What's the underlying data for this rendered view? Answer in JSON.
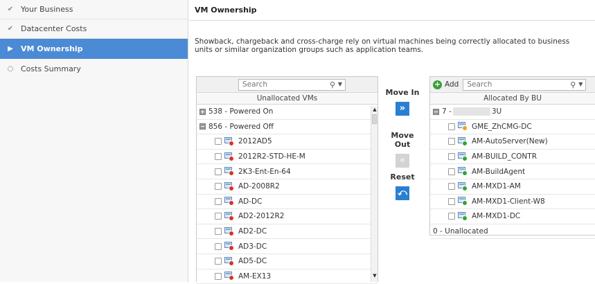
{
  "wizard": {
    "steps": [
      {
        "label": "Your Business",
        "state": "done"
      },
      {
        "label": "Datacenter Costs",
        "state": "done"
      },
      {
        "label": "VM Ownership",
        "state": "active"
      },
      {
        "label": "Costs Summary",
        "state": "pending"
      }
    ]
  },
  "page": {
    "title": "VM Ownership",
    "description": "Showback, chargeback and cross-charge rely on virtual machines being correctly allocated to business units or similar organization groups such as application teams."
  },
  "left_panel": {
    "search_placeholder": "Search",
    "header": "Unallocated VMs",
    "groups": [
      {
        "label": "538 - Powered On",
        "expanded": false
      },
      {
        "label": "856 - Powered Off",
        "expanded": true
      }
    ],
    "items": [
      "2012AD5",
      "2012R2-STD-HE-M",
      "2K3-Ent-En-64",
      "AD-2008R2",
      "AD-DC",
      "AD2-2012R2",
      "AD2-DC",
      "AD3-DC",
      "AD5-DC",
      "AM-EX13"
    ]
  },
  "controls": {
    "move_in_label": "Move In",
    "move_out_label": "Move Out",
    "reset_label": "Reset"
  },
  "right_panel": {
    "add_label": "Add",
    "search_placeholder": "Search",
    "header": "Allocated By BU",
    "bu_prefix": "7 -",
    "bu_suffix": "3U",
    "items": [
      {
        "name": "GME_ZhCMG-DC",
        "status": "warn"
      },
      {
        "name": "AM-AutoServer(New)",
        "status": "on"
      },
      {
        "name": "AM-BUILD_CONTR",
        "status": "on"
      },
      {
        "name": "AM-BuildAgent",
        "status": "on"
      },
      {
        "name": "AM-MXD1-AM",
        "status": "on"
      },
      {
        "name": "AM-MXD1-Client-W8",
        "status": "on"
      },
      {
        "name": "AM-MXD1-DC",
        "status": "on"
      }
    ],
    "unallocated_label": "0 - Unallocated"
  },
  "colors": {
    "active_step": "#4b8ad4",
    "action_button": "#2a7fd0",
    "status_off": "#d9322b",
    "status_on": "#35a236",
    "status_warn": "#f0a21a",
    "add_icon": "#3e9d3a"
  }
}
